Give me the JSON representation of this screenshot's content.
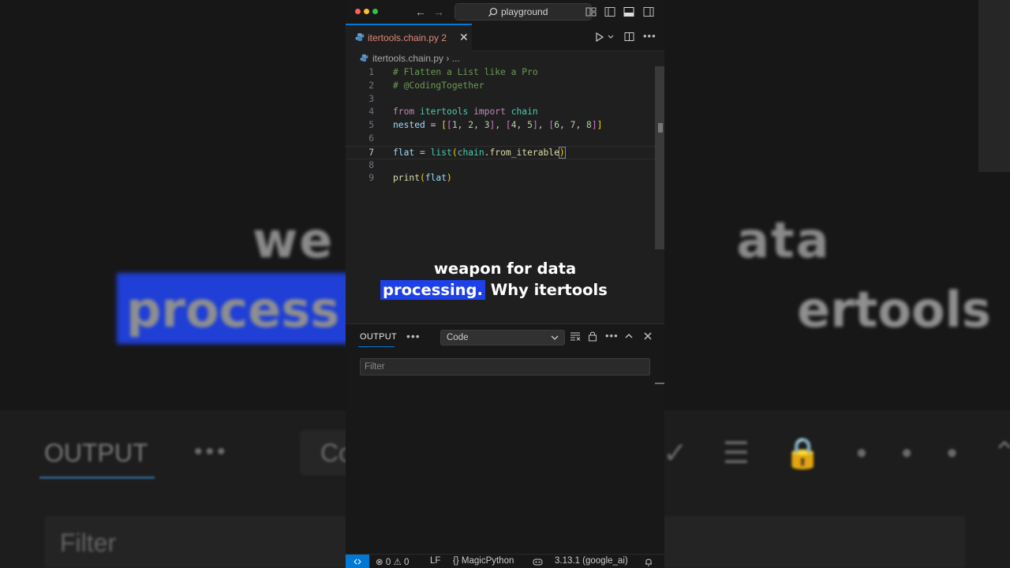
{
  "window": {
    "search_label": "playground"
  },
  "tab": {
    "label": "itertools.chain.py",
    "problems": "2"
  },
  "breadcrumb": {
    "file": "itertools.chain.py",
    "more": "..."
  },
  "editor": {
    "lines": [
      {
        "n": "1",
        "tokens": [
          {
            "t": "# Flatten a List like a Pro",
            "c": "c-com"
          }
        ]
      },
      {
        "n": "2",
        "tokens": [
          {
            "t": "# @CodingTogether",
            "c": "c-com"
          }
        ]
      },
      {
        "n": "3",
        "tokens": []
      },
      {
        "n": "4",
        "tokens": [
          {
            "t": "from",
            "c": "c-kw"
          },
          {
            "t": " "
          },
          {
            "t": "itertools",
            "c": "c-mod"
          },
          {
            "t": " "
          },
          {
            "t": "import",
            "c": "c-kw"
          },
          {
            "t": " "
          },
          {
            "t": "chain",
            "c": "c-mod"
          }
        ]
      },
      {
        "n": "5",
        "tokens": [
          {
            "t": "nested",
            "c": "c-var"
          },
          {
            "t": " = "
          },
          {
            "t": "[",
            "c": "c-br1"
          },
          {
            "t": "[",
            "c": "c-br2"
          },
          {
            "t": "1",
            "c": "c-num"
          },
          {
            "t": ", "
          },
          {
            "t": "2",
            "c": "c-num"
          },
          {
            "t": ", "
          },
          {
            "t": "3",
            "c": "c-num"
          },
          {
            "t": "]",
            "c": "c-br2"
          },
          {
            "t": ", "
          },
          {
            "t": "[",
            "c": "c-br2"
          },
          {
            "t": "4",
            "c": "c-num"
          },
          {
            "t": ", "
          },
          {
            "t": "5",
            "c": "c-num"
          },
          {
            "t": "]",
            "c": "c-br2"
          },
          {
            "t": ", "
          },
          {
            "t": "[",
            "c": "c-br2"
          },
          {
            "t": "6",
            "c": "c-num"
          },
          {
            "t": ", "
          },
          {
            "t": "7",
            "c": "c-num"
          },
          {
            "t": ", "
          },
          {
            "t": "8",
            "c": "c-num"
          },
          {
            "t": "]",
            "c": "c-br2"
          },
          {
            "t": "]",
            "c": "c-br1"
          }
        ]
      },
      {
        "n": "6",
        "tokens": []
      },
      {
        "n": "7",
        "current": true,
        "tokens": [
          {
            "t": "flat",
            "c": "c-var"
          },
          {
            "t": " = "
          },
          {
            "t": "list",
            "c": "c-mod"
          },
          {
            "t": "(",
            "c": "c-br1"
          },
          {
            "t": "chain",
            "c": "c-mod"
          },
          {
            "t": "."
          },
          {
            "t": "from_iterable",
            "c": "c-fn"
          },
          {
            "t": ")",
            "c": "c-br1 c-cur"
          }
        ]
      },
      {
        "n": "8",
        "tokens": []
      },
      {
        "n": "9",
        "tokens": [
          {
            "t": "print",
            "c": "c-fn"
          },
          {
            "t": "(",
            "c": "c-br1"
          },
          {
            "t": "flat",
            "c": "c-var"
          },
          {
            "t": ")",
            "c": "c-br1"
          }
        ]
      }
    ]
  },
  "caption": {
    "line1": "weapon for data",
    "line2_highlight": "processing.",
    "line2_rest": " Why itertools"
  },
  "background_caption": {
    "line1_left": "we",
    "line1_right": "ata",
    "line2_left": "process",
    "line2_right": "ertools",
    "output": "OUTPUT",
    "select": "Co",
    "filter": "Filter"
  },
  "panel": {
    "title": "OUTPUT",
    "select_value": "Code",
    "filter_placeholder": "Filter"
  },
  "statusbar": {
    "errors": "0",
    "warnings": "0",
    "eol": "LF",
    "language": "MagicPython",
    "interpreter": "3.13.1 (google_ai)"
  },
  "colors": {
    "accent": "#0078d4",
    "caption_highlight": "#1e40e8",
    "tab_label": "#e2877a"
  }
}
